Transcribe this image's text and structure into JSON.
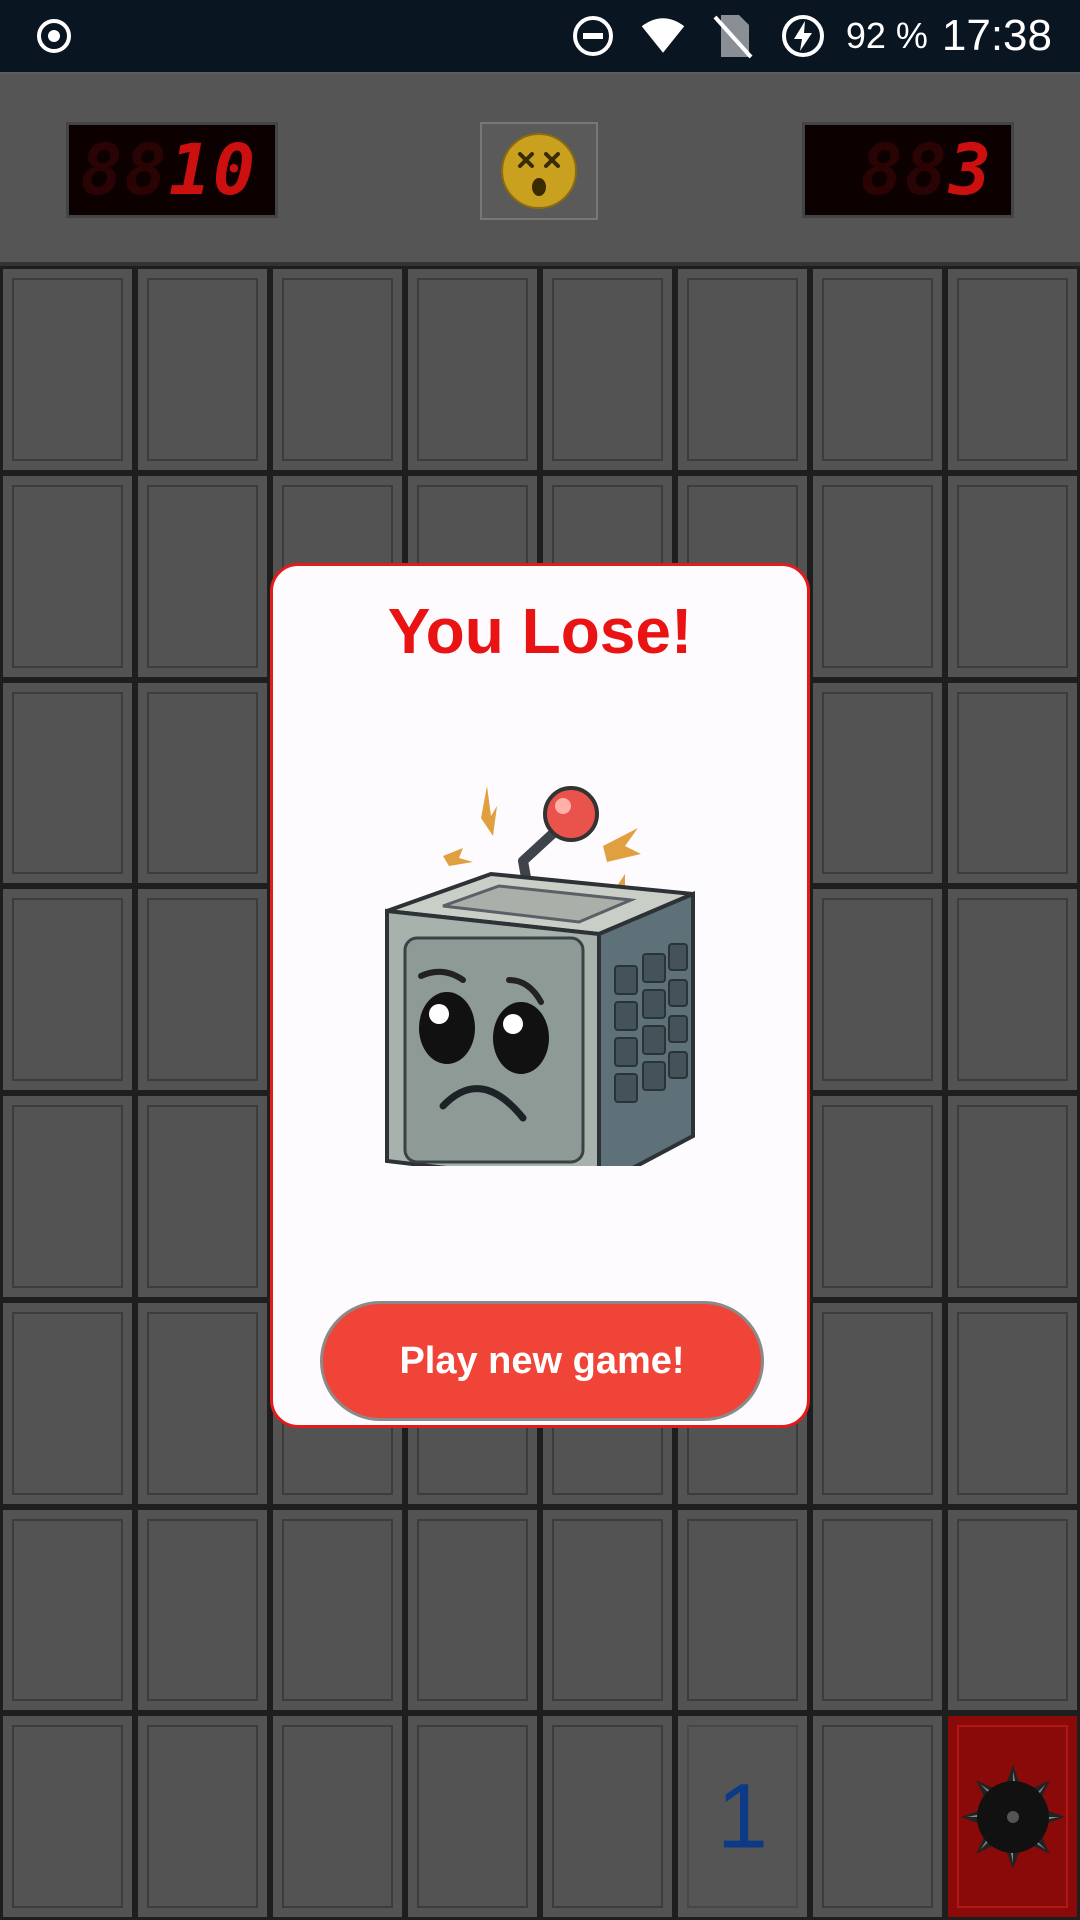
{
  "status_bar": {
    "battery_percent": "92 %",
    "time": "17:38",
    "icons": [
      "record-icon",
      "dnd-icon",
      "wifi-icon",
      "no-sim-icon",
      "battery-charging-icon"
    ]
  },
  "header": {
    "mines_counter": {
      "ghost": "88",
      "value": "10"
    },
    "face": "dead-face-icon",
    "timer": {
      "ghost": "88",
      "value": "3"
    }
  },
  "board": {
    "rows": 8,
    "cols": 8,
    "revealed_number": {
      "row": 7,
      "col": 5,
      "value": "1"
    },
    "exploded": {
      "row": 7,
      "col": 7,
      "icon": "mine-icon"
    }
  },
  "dialog": {
    "title": "You Lose!",
    "image": "sad-bomb-robot-image",
    "button_label": "Play new game!"
  },
  "colors": {
    "title_red": "#ea1313",
    "button_red": "#f04438",
    "lcd_red": "#cc1010",
    "number_blue": "#0d3a86",
    "exploded_cell": "#8a0a0a"
  }
}
